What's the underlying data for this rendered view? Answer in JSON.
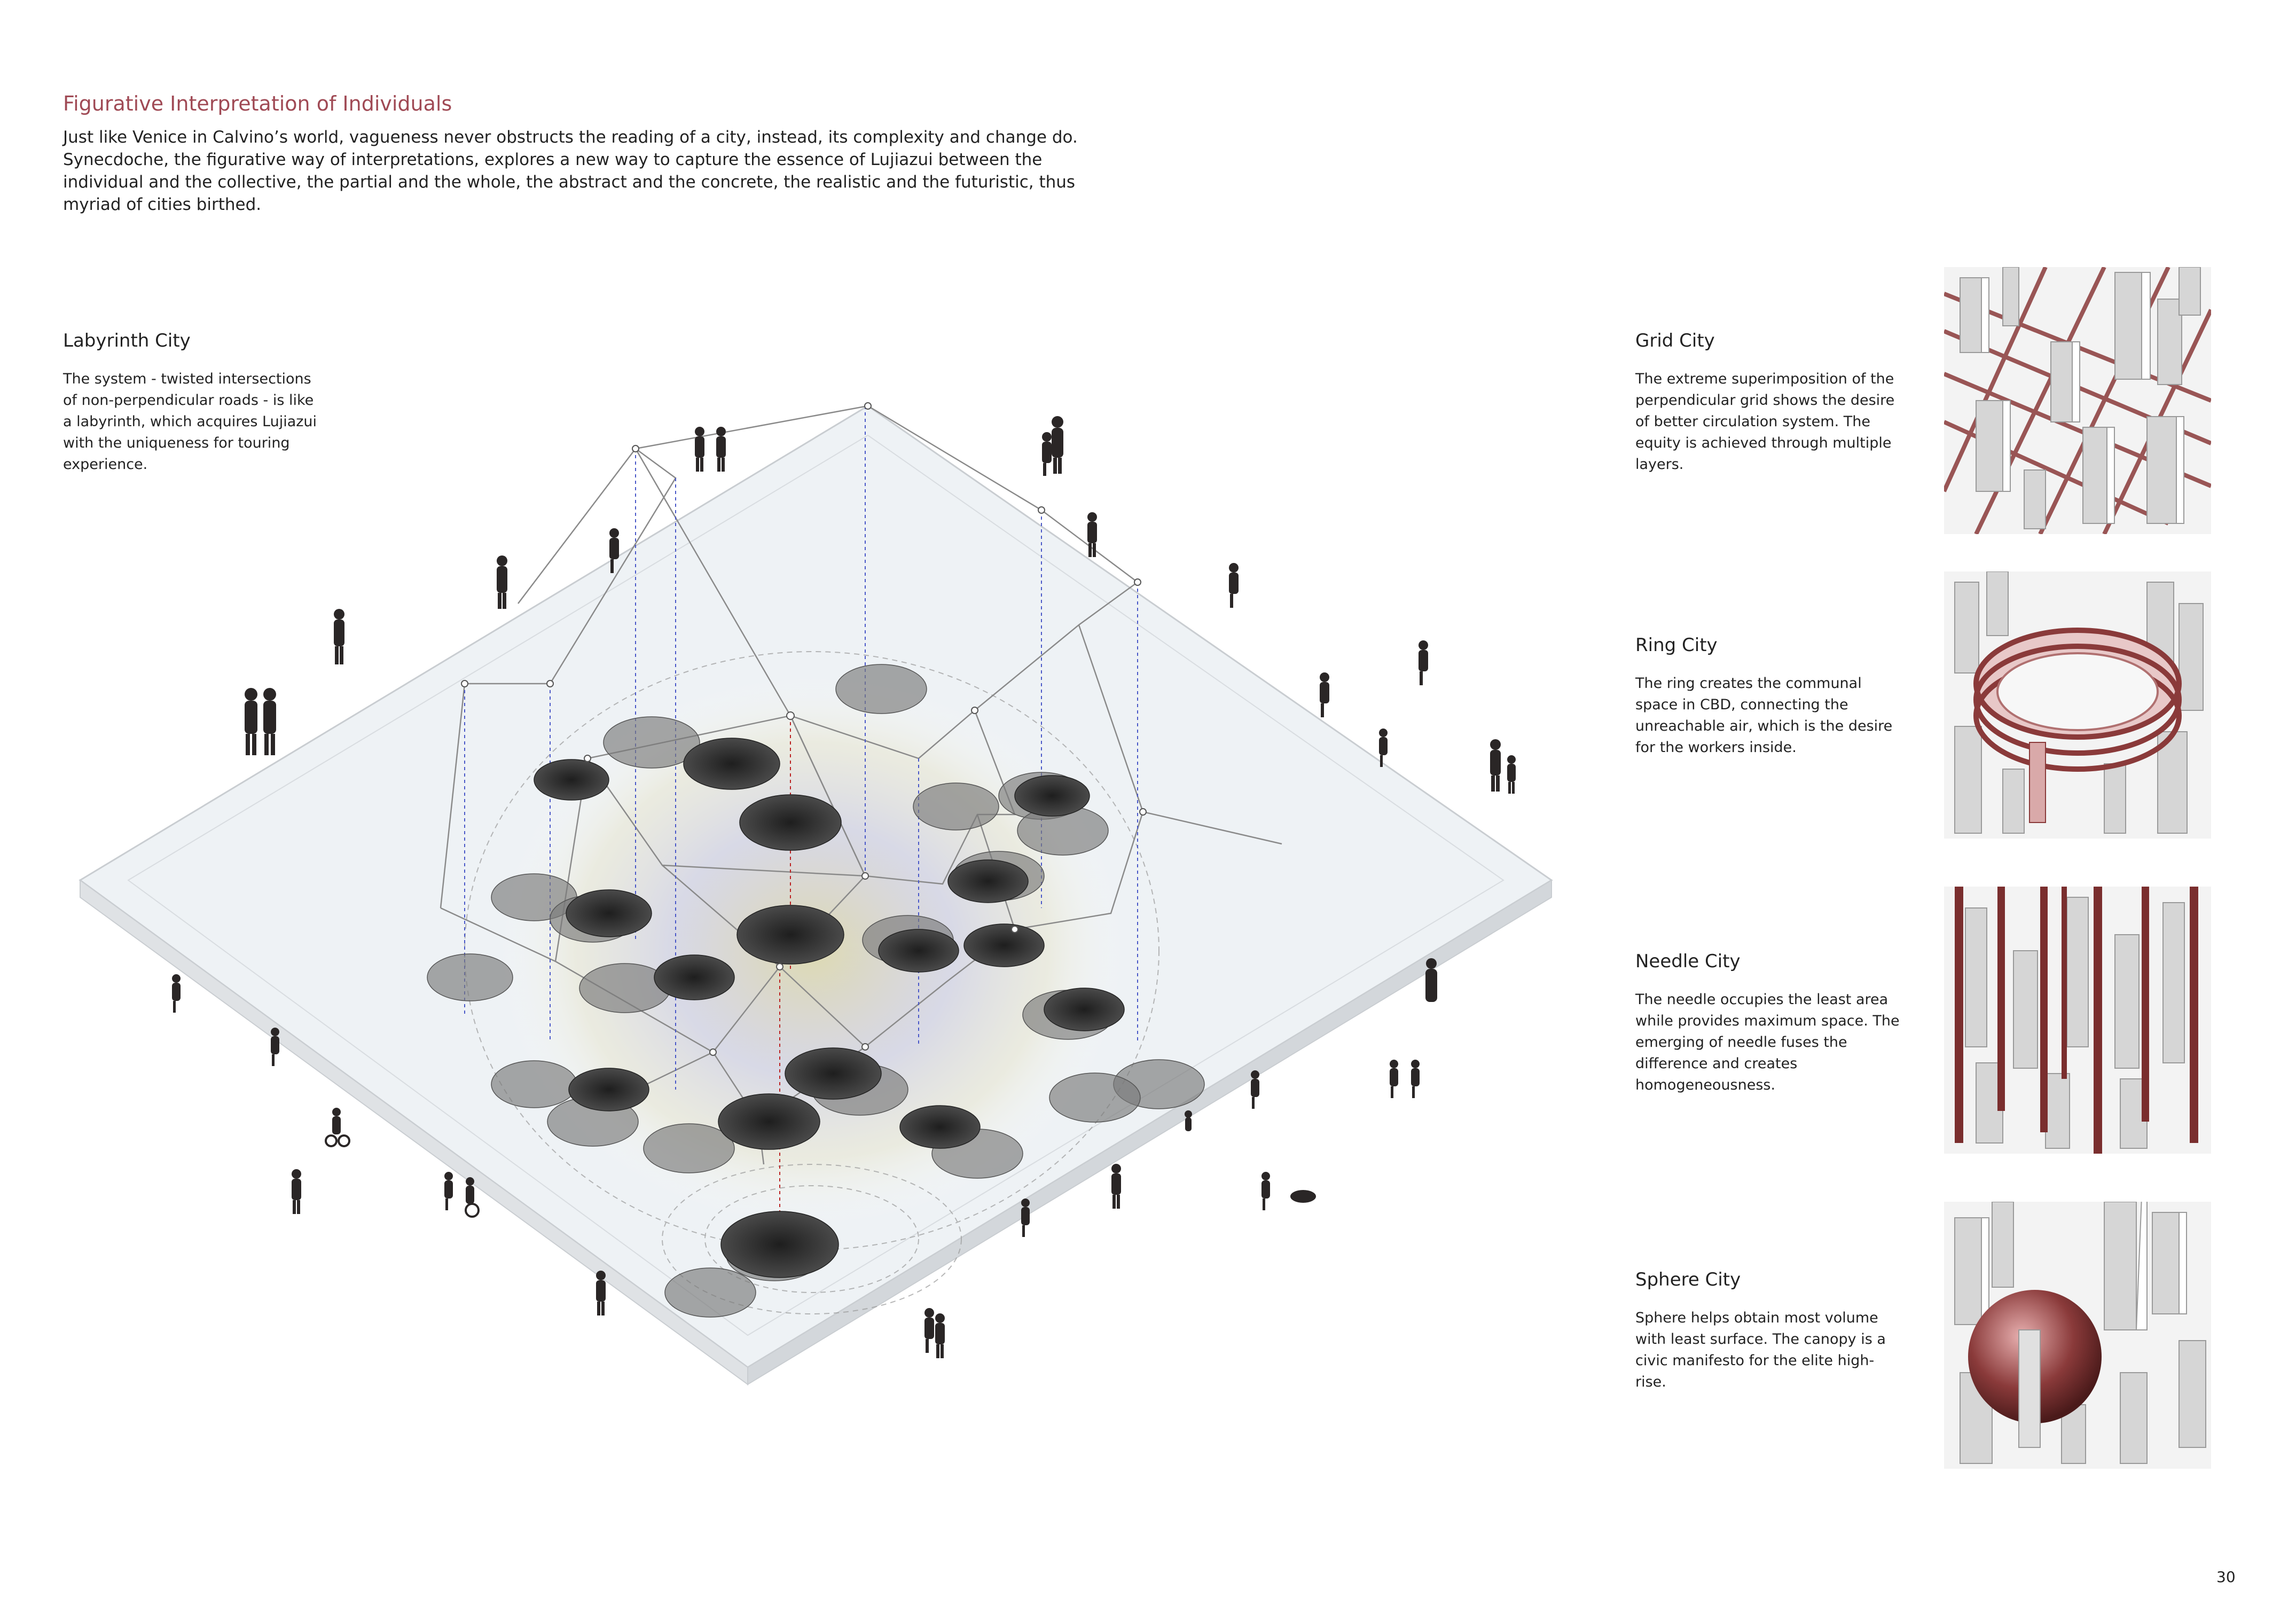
{
  "header": {
    "title": "Figurative Interpretation of Individuals",
    "intro": "Just like Venice in Calvino’s world, vagueness never obstructs the reading of a city, instead, its complexity and change do. Synecdoche, the figurative way of interpretations, explores a new way to capture the essence of Lujiazui between the individual and the collective, the partial and the whole, the abstract and the concrete, the realistic and the futuristic, thus myriad of cities birthed."
  },
  "sections": {
    "labyrinth": {
      "title": "Labyrinth City",
      "body": "The system - twisted intersections of non-perpendicular roads - is like a labyrinth, which acquires Lujiazui with the uniqueness for touring experience."
    },
    "grid": {
      "title": "Grid City",
      "body": "The extreme superimposition of the perpendicular grid shows the desire of better circulation system. The equity is achieved through multiple layers."
    },
    "ring": {
      "title": "Ring City",
      "body": "The ring creates the communal space in CBD, connecting the unreachable air, which is the desire for the workers inside."
    },
    "needle": {
      "title": "Needle City",
      "body": "The needle occupies the least area while provides maximum space. The emerging of needle fuses the difference and creates homogeneousness."
    },
    "sphere": {
      "title": "Sphere City",
      "body": "Sphere helps obtain most volume with least surface.  The canopy is a civic manifesto for the elite high-rise."
    }
  },
  "footer": {
    "page_number": "30"
  },
  "colors": {
    "title_accent": "#a04a55",
    "structure_red": "#8a3a3a",
    "disc_dark": "#3a3a3a"
  }
}
